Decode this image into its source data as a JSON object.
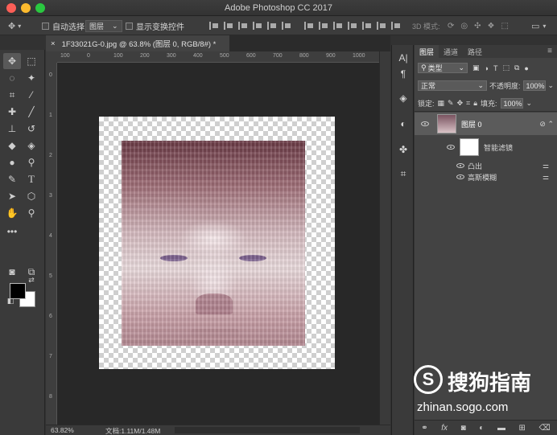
{
  "window": {
    "title": "Adobe Photoshop CC 2017"
  },
  "options_bar": {
    "auto_select_label": "自动选择:",
    "auto_select_value": "图层",
    "show_transform_label": "显示变换控件",
    "mode_3d_label": "3D 模式:"
  },
  "document": {
    "tab_title": "1F33021G-0.jpg @ 63.8% (图层 0, RGB/8#) *",
    "zoom": "63.82%",
    "doc_info": "文档:1.11M/1.48M",
    "ruler_top": [
      "100",
      "0",
      "100",
      "200",
      "300",
      "400",
      "500",
      "600",
      "700",
      "800",
      "900",
      "1000"
    ],
    "ruler_left": [
      "0",
      "1",
      "2",
      "3",
      "4",
      "5",
      "6",
      "7",
      "8"
    ]
  },
  "toolbar": {
    "tools": [
      "move-icon",
      "marquee-icon",
      "lasso-icon",
      "magic-wand-icon",
      "crop-icon",
      "eyedropper-icon",
      "healing-icon",
      "brush-icon",
      "stamp-icon",
      "history-brush-icon",
      "eraser-icon",
      "bucket-icon",
      "blur-icon",
      "dodge-icon",
      "pen-icon",
      "type-icon",
      "path-select-icon",
      "shape-icon",
      "hand-icon",
      "zoom-icon"
    ],
    "foreground_color": "#000000",
    "background_color": "#ffffff"
  },
  "layers_panel": {
    "tabs": [
      "图层",
      "通道",
      "路径"
    ],
    "active_tab": "图层",
    "filter_kind": "类型",
    "blend_mode": "正常",
    "opacity_label": "不透明度:",
    "opacity_value": "100%",
    "lock_label": "锁定:",
    "fill_label": "填充:",
    "fill_value": "100%",
    "layers": [
      {
        "name": "图层 0",
        "visible": true,
        "selected": true
      },
      {
        "name": "智能滤镜",
        "visible": true
      },
      {
        "name": "凸出",
        "visible": true
      },
      {
        "name": "高斯模糊",
        "visible": true
      }
    ]
  },
  "watermark": {
    "logo_letter": "S",
    "cn": "搜狗指南",
    "url": "zhinan.sogo.com"
  }
}
